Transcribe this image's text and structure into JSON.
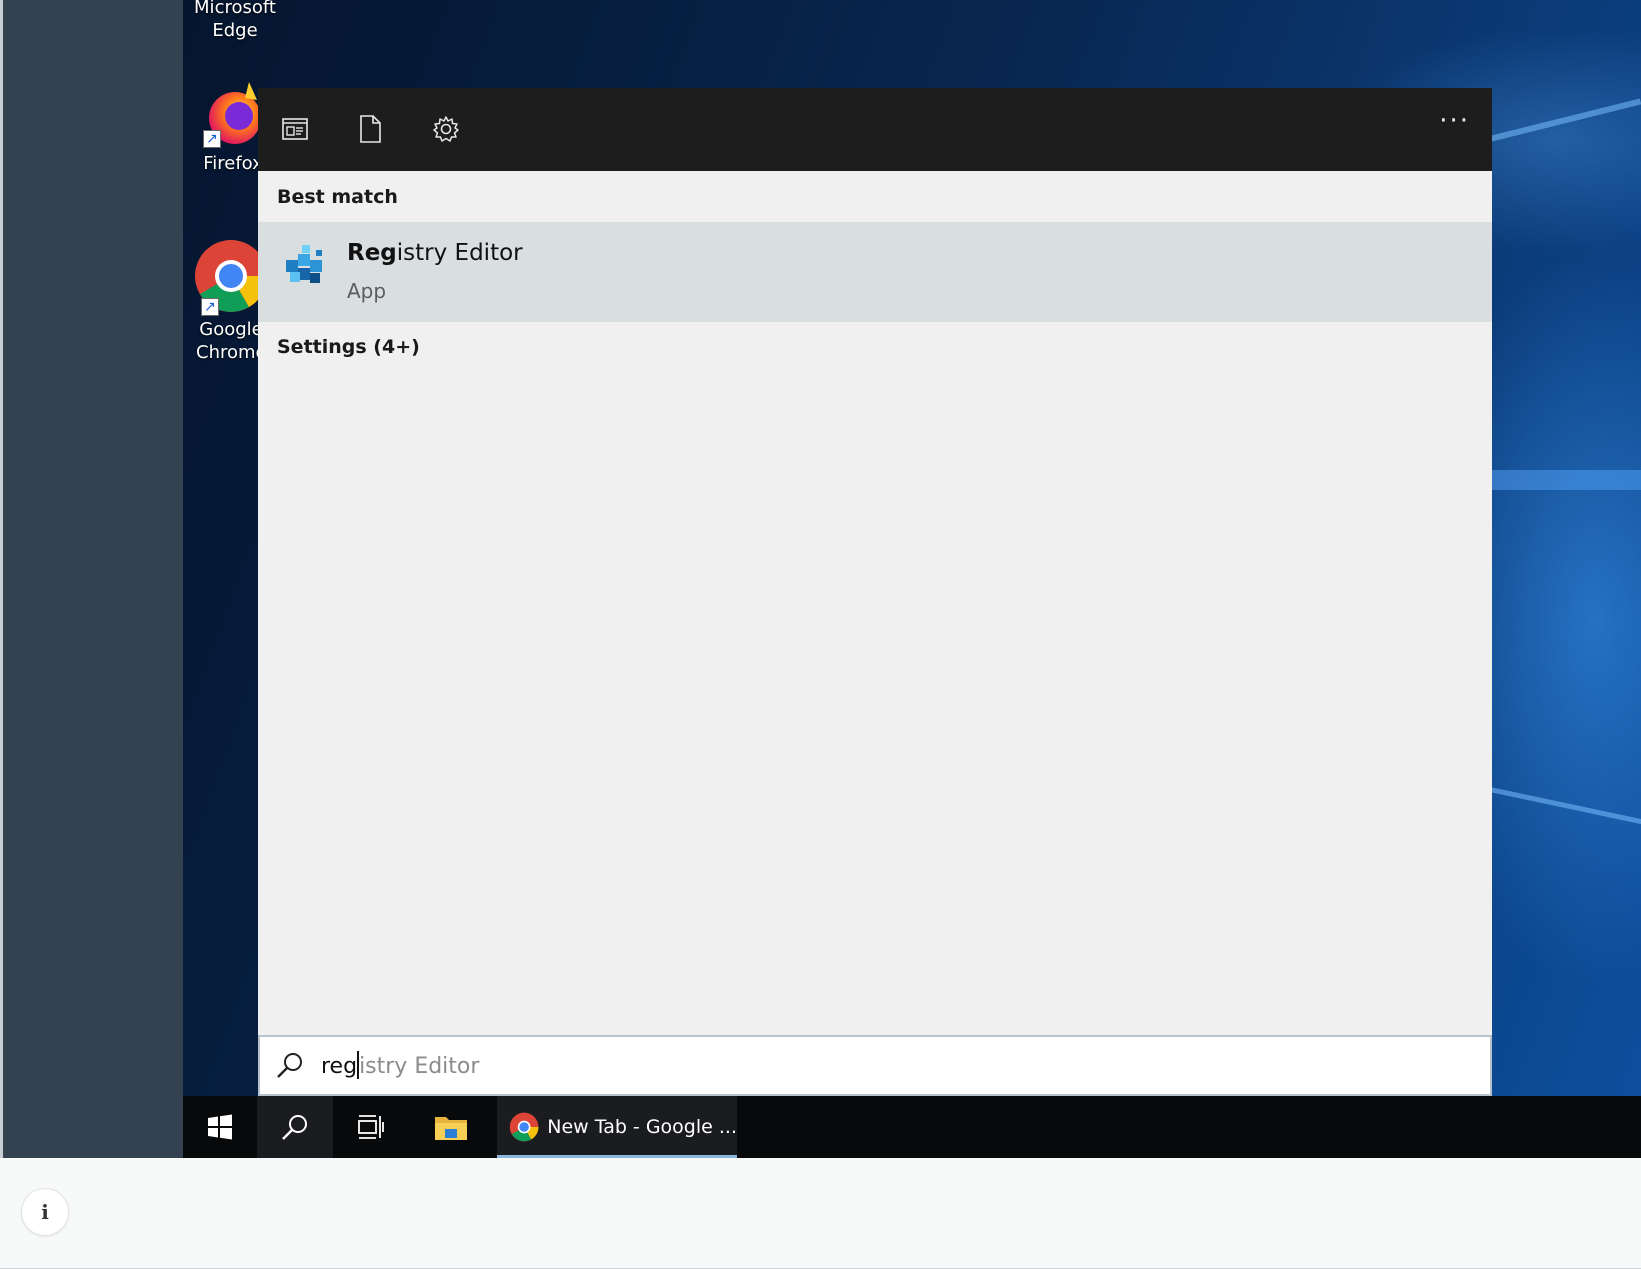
{
  "desktop": {
    "icons": [
      {
        "label": "Microsoft Edge",
        "icon": "edge-icon"
      },
      {
        "label": "Firefox",
        "icon": "firefox-icon"
      },
      {
        "label": "Google Chrome",
        "icon": "chrome-icon"
      }
    ]
  },
  "search_panel": {
    "top_icons": [
      "apps-filter-icon",
      "documents-filter-icon",
      "settings-filter-icon"
    ],
    "more_label": "···",
    "best_match_header": "Best match",
    "best_match": {
      "title_bold": "Reg",
      "title_rest": "istry Editor",
      "type": "App",
      "icon": "registry-editor-icon"
    },
    "settings_header": "Settings (4+)",
    "search_box": {
      "typed": "reg",
      "suggestion": "istry Editor"
    }
  },
  "taskbar": {
    "items": [
      "start-icon",
      "search-icon",
      "task-view-icon",
      "file-explorer-icon"
    ],
    "active_app_label": "New Tab - Google ..."
  },
  "info_button_label": "i",
  "colors": {
    "flyout_bg": "#f0f0f0",
    "flyout_top": "#1c1d1c",
    "selected_result": "#d9dee1",
    "taskbar": "#08090b",
    "app_underline": "#8db6de"
  }
}
